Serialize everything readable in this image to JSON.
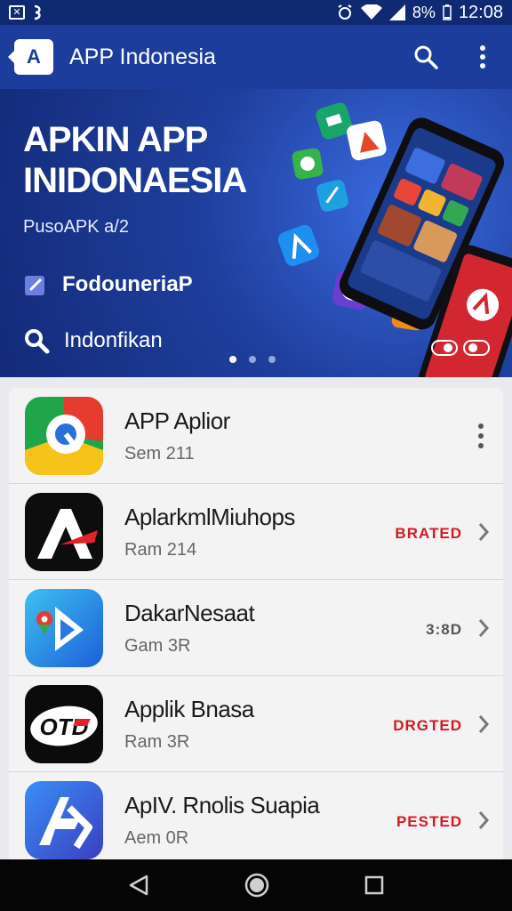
{
  "status_bar": {
    "battery": "8%",
    "time": "12:08"
  },
  "app_bar": {
    "logo_letter": "A",
    "title": "APP Indonesia"
  },
  "banner": {
    "title_line1": "APKIN APP",
    "title_line2": "INIDONAESIA",
    "subtitle": "PusoAPK  a/2",
    "row1_label": "FodouneriaP",
    "row2_label": "Indonfikan",
    "dots_total": 3,
    "dots_active": 1
  },
  "apps": [
    {
      "name": "APP Aplior",
      "sub": "Sem 211",
      "status": "",
      "icon": "map-pin-icon"
    },
    {
      "name": "AplarkmlMiuhops",
      "sub": "Ram 214",
      "status": "BRATED",
      "icon": "a-logo-icon"
    },
    {
      "name": "DakarNesaat",
      "sub": "Gam 3R",
      "status": "3:8D",
      "icon": "maps-d-icon"
    },
    {
      "name": "Applik Bnasa",
      "sub": "Ram 3R",
      "status": "DRGTED",
      "icon": "otd-logo-icon"
    },
    {
      "name": "ApIV. Rnolis Suapia",
      "sub": "Aem 0R",
      "status": "PESTED",
      "icon": "ad-logo-icon"
    }
  ],
  "colors": {
    "primary": "#1c3d9c",
    "accent_red": "#d11b20",
    "status_bar": "#0f2a72"
  }
}
